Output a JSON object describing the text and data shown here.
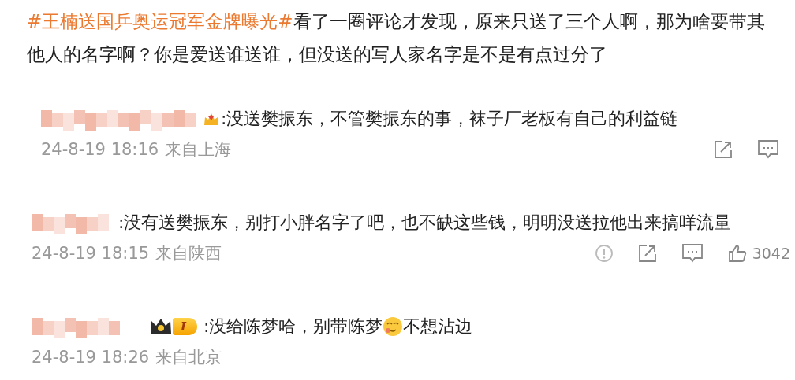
{
  "post": {
    "hashtag": "#王楠送国乒奥运冠军金牌曝光#",
    "text": "看了一圈评论才发现，原来只送了三个人啊，那为啥要带其他人的名字啊？你是爱送谁送谁，但没送的写人家名字是不是有点过分了"
  },
  "comments": [
    {
      "badge": {
        "kind": "gem"
      },
      "content": [
        {
          "kind": "text",
          "text": ":没送樊振东，不管樊振东的事，袜子厂老板有自己的利益链"
        }
      ],
      "date": "24-8-19 18:16",
      "location": "来自上海",
      "actions": [
        {
          "kind": "share"
        },
        {
          "kind": "reply"
        }
      ]
    },
    {
      "content": [
        {
          "kind": "text",
          "text": ":没有送樊振东，别打小胖名字了吧，也不缺这些钱，明明没送拉他出来搞咩流量"
        }
      ],
      "date": "24-8-19 18:15",
      "location": "来自陕西",
      "actions": [
        {
          "kind": "report"
        },
        {
          "kind": "share"
        },
        {
          "kind": "reply"
        },
        {
          "kind": "like",
          "count": "3042"
        }
      ]
    },
    {
      "badge": {
        "kind": "crown",
        "label": "I"
      },
      "content": [
        {
          "kind": "text",
          "text": ":没给陈梦哈，别带陈梦"
        },
        {
          "kind": "emoji"
        },
        {
          "kind": "text",
          "text": "不想沾边"
        }
      ],
      "date": "24-8-19 18:26",
      "location": "来自北京"
    }
  ]
}
